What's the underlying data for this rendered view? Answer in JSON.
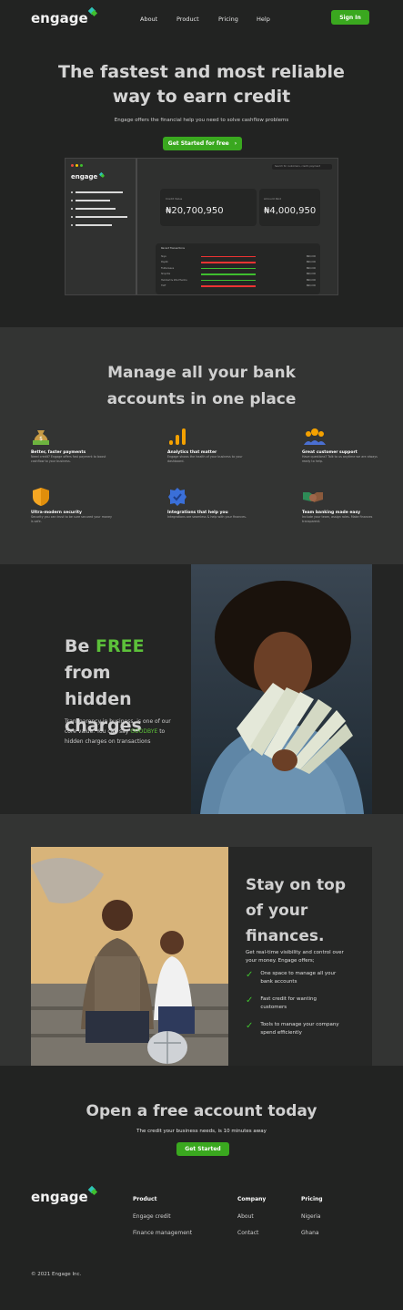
{
  "brand": {
    "name": "engage"
  },
  "nav": {
    "about": "About",
    "product": "Product",
    "pricing": "Pricing",
    "help": "Help",
    "signin": "Sign In"
  },
  "hero": {
    "title_line1": "The fastest and most reliable",
    "title_line2": "way to earn credit",
    "subtitle": "Engage offers the financial help you need to solve cashflow problems",
    "cta": "Get Started for free",
    "cta_arrow": "›"
  },
  "dashboard": {
    "search_placeholder": "Search for customers, credit, payment",
    "card1_label": "Credit Value",
    "card1_value": "₦20,700,950",
    "card2_label": "Amount Paid",
    "card2_value": "₦4,000,950",
    "table_title": "Recent Transactions",
    "rows": [
      {
        "name": "Skye",
        "amount": "₦90,000"
      },
      {
        "name": "Paystk",
        "amount": "₦90,000"
      },
      {
        "name": "Flutterwave",
        "amount": "₦90,000"
      },
      {
        "name": "Shoprite",
        "amount": "₦90,000"
      },
      {
        "name": "Hubmart & Zita Pharma",
        "amount": "₦90,000"
      },
      {
        "name": "TGIF",
        "amount": "₦90,000"
      }
    ]
  },
  "manage": {
    "title_line1": "Manage all your bank",
    "title_line2": "accounts in one place",
    "features": [
      {
        "icon": "money-bag-icon",
        "title": "Better, faster payments",
        "desc": "Need credit? Engage offers fast payment to boost cashflow to your business."
      },
      {
        "icon": "analytics-chart-icon",
        "title": "Analytics that matter",
        "desc": "Engage shows the health of your business to your dashboard."
      },
      {
        "icon": "customer-support-icon",
        "title": "Great customer support",
        "desc": "Have questions? Talk to us anytime we are always ready to help."
      },
      {
        "icon": "shield-icon",
        "title": "Ultra-modern security",
        "desc": "Security you can trust to be sure secured your money is safe."
      },
      {
        "icon": "integration-badge-icon",
        "title": "Integrations that help you",
        "desc": "Integrations are seamless & help with your finances."
      },
      {
        "icon": "handshake-icon",
        "title": "Team banking made easy",
        "desc": "Include your team, assign roles. Make finances transparent."
      }
    ]
  },
  "free": {
    "title_pre": "Be ",
    "title_free": "FREE",
    "title_post": " from",
    "title_line2": "hidden",
    "title_line3": "charges",
    "desc_pre": "Transparency in business, is one of our core value. You can say ",
    "desc_highlight": "GOODBYE",
    "desc_post": " to hidden charges on transactions"
  },
  "finances": {
    "title_line1": "Stay on top",
    "title_line2": "of your",
    "title_line3": "finances.",
    "intro": "Get real-time visibility and control over your money. Engage offers;",
    "items": [
      "One space to manage all your bank accounts",
      "Fast credit for wanting customers",
      "Tools to manage your company spend efficiently"
    ]
  },
  "open": {
    "title": "Open a free account today",
    "subtitle": "The credit your business needs, is 10 minutes away",
    "cta": "Get Started"
  },
  "footer": {
    "product": {
      "head": "Product",
      "links": [
        "Engage credit",
        "Finance management"
      ]
    },
    "company": {
      "head": "Company",
      "links": [
        "About",
        "Contact"
      ]
    },
    "pricing": {
      "head": "Pricing",
      "links": [
        "Nigeria",
        "Ghana"
      ]
    },
    "copyright": "© 2021 Engage Inc."
  },
  "colors": {
    "accent": "#3aa81f",
    "bg": "#222322",
    "section": "#333433"
  }
}
